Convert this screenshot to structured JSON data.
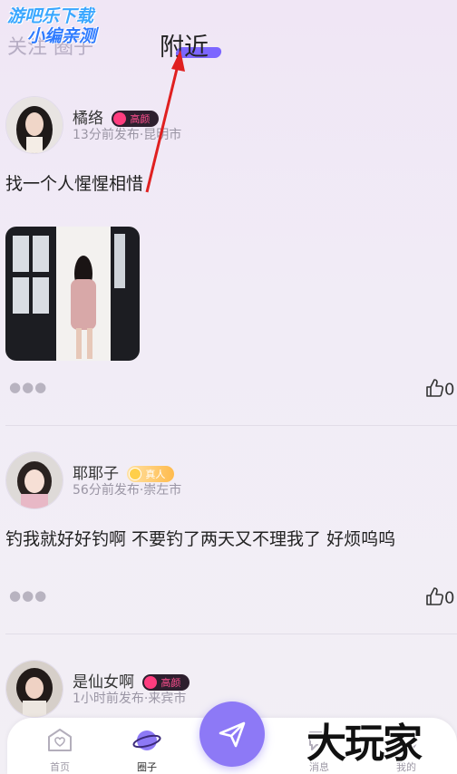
{
  "watermark": {
    "line1": "游吧乐下载",
    "line2": "小编亲测"
  },
  "tabs": {
    "follow": "关注 圈子",
    "nearby": "附近"
  },
  "posts": [
    {
      "name": "橘络",
      "badge": "高颜",
      "meta": "13分前发布·昆明市",
      "content": "找一个人惺惺相惜",
      "likes": "0"
    },
    {
      "name": "耶耶子",
      "badge": "真人",
      "meta": "56分前发布·崇左市",
      "content": "钓我就好好钓啊 不要钓了两天又不理我了 好烦呜呜",
      "likes": "0"
    },
    {
      "name": "是仙女啊",
      "badge": "高颜",
      "meta": "1小时前发布·来宾市"
    }
  ],
  "tabbar": {
    "home": "首页",
    "circle": "圈子",
    "messages": "消息",
    "mine": "我的"
  },
  "brand_watermark": "大玩家",
  "colors": {
    "accent": "#8d79f6",
    "underline": "#7c66ff",
    "arrow": "#e02020",
    "badge_pink": "#ff4f8f",
    "badge_gold": "#ffbb4d"
  }
}
